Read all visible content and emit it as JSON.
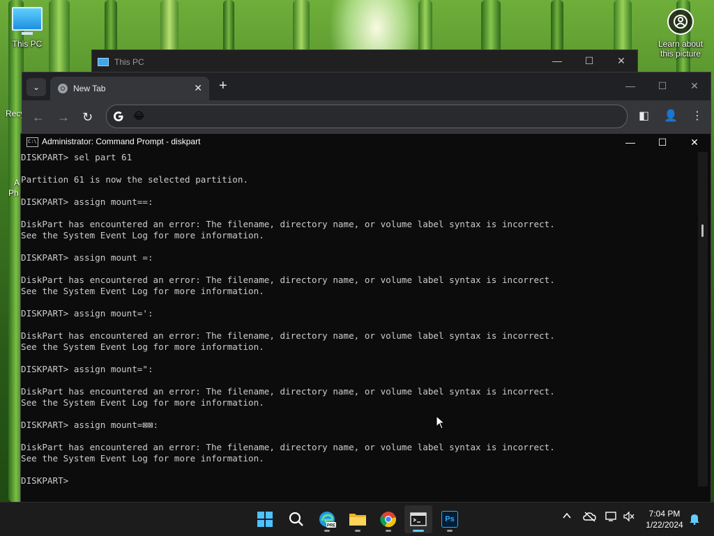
{
  "desktop": {
    "icons": [
      {
        "label": "This PC"
      },
      {
        "label": "Recy"
      },
      {
        "label": "A"
      },
      {
        "label": "Ph"
      }
    ],
    "learn_about_picture": "Learn about this picture"
  },
  "explorer_window": {
    "title": "This PC",
    "controls": {
      "minimize": "—",
      "maximize": "☐",
      "close": "✕"
    }
  },
  "chrome": {
    "tab": {
      "title": "New Tab",
      "close": "✕"
    },
    "new_tab": "+",
    "tab_search": "⌄",
    "nav": {
      "back": "←",
      "forward": "→",
      "reload": "↻"
    },
    "omnibox": {
      "emoji": "😂",
      "value": ""
    },
    "controls": {
      "minimize": "—",
      "maximize": "☐",
      "close": "✕"
    },
    "toolbar_right": {
      "side_panel": "◧",
      "profile": "👤",
      "menu": "⋮"
    }
  },
  "cmd": {
    "title": "Administrator: Command Prompt - diskpart",
    "controls": {
      "minimize": "—",
      "maximize": "☐",
      "close": "✕"
    },
    "lines": [
      "DISKPART> sel part 61",
      "",
      "Partition 61 is now the selected partition.",
      "",
      "DISKPART> assign mount==:",
      "",
      "DiskPart has encountered an error: The filename, directory name, or volume label syntax is incorrect.",
      "See the System Event Log for more information.",
      "",
      "DISKPART> assign mount =:",
      "",
      "DiskPart has encountered an error: The filename, directory name, or volume label syntax is incorrect.",
      "See the System Event Log for more information.",
      "",
      "DISKPART> assign mount=':",
      "",
      "DiskPart has encountered an error: The filename, directory name, or volume label syntax is incorrect.",
      "See the System Event Log for more information.",
      "",
      "DISKPART> assign mount=\":",
      "",
      "DiskPart has encountered an error: The filename, directory name, or volume label syntax is incorrect.",
      "See the System Event Log for more information.",
      "",
      "DISKPART> assign mount=⊠⊠:",
      "",
      "DiskPart has encountered an error: The filename, directory name, or volume label syntax is incorrect.",
      "See the System Event Log for more information.",
      "",
      "DISKPART> "
    ]
  },
  "taskbar": {
    "apps": [
      {
        "name": "start",
        "icon": "windows-start-icon"
      },
      {
        "name": "search",
        "icon": "search-icon"
      },
      {
        "name": "edge-pre",
        "icon": "edge-icon",
        "badge": "PRE"
      },
      {
        "name": "file-explorer",
        "icon": "folder-icon"
      },
      {
        "name": "chrome",
        "icon": "chrome-icon"
      },
      {
        "name": "terminal",
        "icon": "terminal-icon",
        "active": true
      },
      {
        "name": "photoshop",
        "icon": "photoshop-icon",
        "label": "Ps"
      }
    ],
    "tray": {
      "chevron": "^"
    },
    "clock": {
      "time": "7:04 PM",
      "date": "1/22/2024"
    }
  },
  "colors": {
    "cmd_background": "#0c0c0c",
    "cmd_text": "#cccccc",
    "chrome_frame": "#202124",
    "taskbar": "#1c1c1c",
    "accent": "#60cdff"
  }
}
